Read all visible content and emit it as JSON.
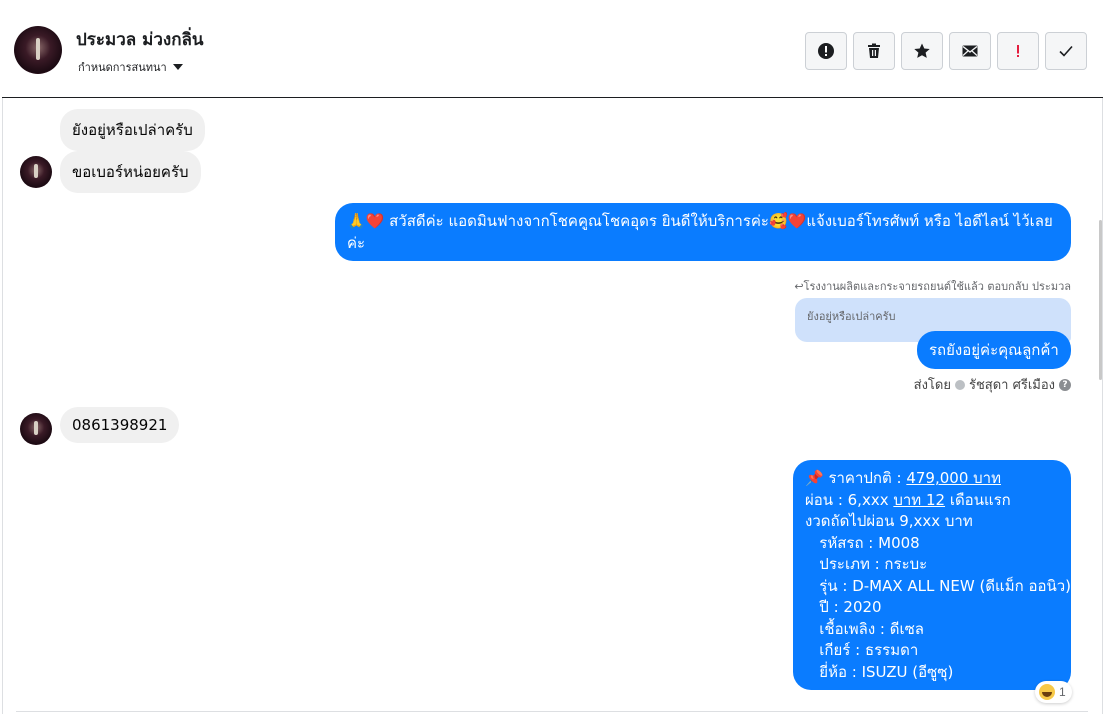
{
  "header": {
    "contact_name": "ประมวล ม่วงกลิ่น",
    "subtitle": "กำหนดการสนทนา",
    "actions": [
      {
        "name": "report-spam-button",
        "icon": "alert-circle-icon"
      },
      {
        "name": "delete-button",
        "icon": "trash-icon"
      },
      {
        "name": "star-button",
        "icon": "star-icon"
      },
      {
        "name": "mark-unread-button",
        "icon": "envelope-icon"
      },
      {
        "name": "mark-important-button",
        "icon": "exclamation-icon"
      },
      {
        "name": "mark-done-button",
        "icon": "checkmark-icon"
      }
    ]
  },
  "messages": {
    "in_1": "ยังอยู่หรือเปล่าครับ",
    "in_2": "ขอเบอร์หน่อยครับ",
    "out_1": "🙏❤️ สวัสดีค่ะ แอดมินฟางจากโชคคูณโชคอุดร ยินดีให้บริการค่ะ🥰❤️แจ้งเบอร์โทรศัพท์ หรือ ไอดีไลน์  ไว้เลยค่ะ",
    "reply_meta": "↩โรงงานผลิตและกระจายรถยนต์ใช้แล้ว ตอบกลับ ประมวล",
    "reply_quote": "ยังอยู่หรือเปล่าครับ",
    "out_2": "รถยังอยู่ค่ะคุณลูกค้า",
    "sent_by_prefix": "ส่งโดย",
    "sent_by_name": "รัชสุดา ศรีเมือง",
    "in_3": "0861398921",
    "offer": {
      "l1_prefix": "📌 ราคาปกติ : ",
      "l1_price": "479,000 บาท",
      "l2_prefix": " ผ่อน : 6,xxx ",
      "l2_link": "บาท 12",
      "l2_suffix": " เดือนแรก",
      "l3": "งวดถัดไปผ่อน 9,xxx บาท",
      "l4": "   รหัสรถ : M008",
      "l5": "   ประเภท : กระบะ",
      "l6": "   รุ่น : D-MAX ALL NEW (ดีแม็ก ออนิว)",
      "l7": "   ปี : 2020",
      "l8": "   เชื้อเพลิง : ดีเซล",
      "l9": "   เกียร์ : ธรรมดา",
      "l10": "   ยี่ห้อ : ISUZU (อีซูซุ)"
    },
    "reaction_count": "1"
  }
}
